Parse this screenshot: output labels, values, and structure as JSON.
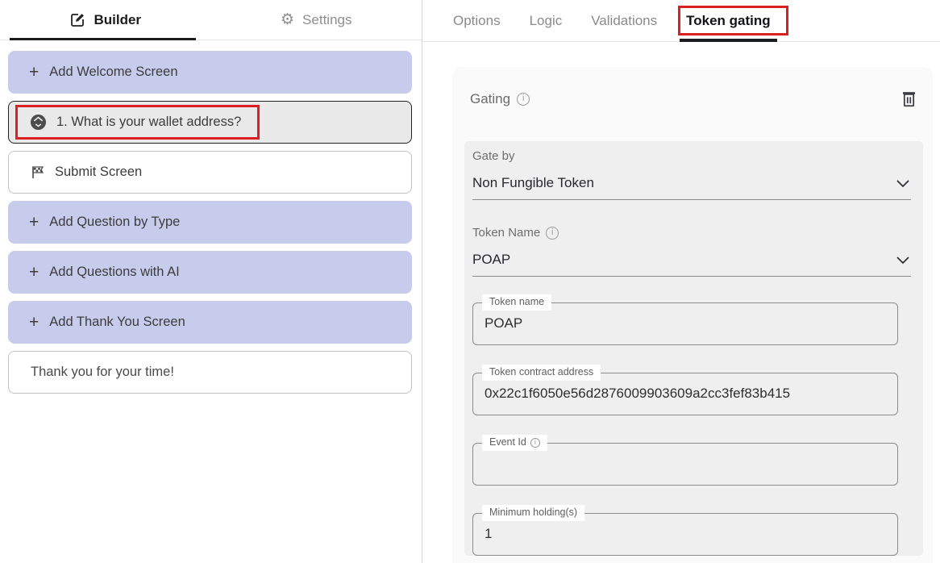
{
  "left_panel": {
    "tabs": [
      {
        "label": "Builder",
        "active": true
      },
      {
        "label": "Settings",
        "active": false
      }
    ],
    "items": [
      {
        "type": "add",
        "label": "Add Welcome Screen"
      },
      {
        "type": "question",
        "label": "1. What is your wallet address?",
        "selected": true,
        "annotated": true
      },
      {
        "type": "submit",
        "label": "Submit Screen"
      },
      {
        "type": "add",
        "label": "Add Question by Type"
      },
      {
        "type": "add",
        "label": "Add Questions with AI"
      },
      {
        "type": "add",
        "label": "Add Thank You Screen"
      },
      {
        "type": "plain",
        "label": "Thank you for your time!"
      }
    ]
  },
  "right_panel": {
    "tabs": [
      {
        "label": "Options",
        "active": false
      },
      {
        "label": "Logic",
        "active": false
      },
      {
        "label": "Validations",
        "active": false
      },
      {
        "label": "Token gating",
        "active": true,
        "annotated": true
      }
    ],
    "section": {
      "title": "Gating",
      "gate_by": {
        "label": "Gate by",
        "value": "Non Fungible Token"
      },
      "token_name": {
        "label": "Token Name",
        "value": "POAP",
        "has_info": true
      },
      "fields": [
        {
          "label": "Token name",
          "value": "POAP",
          "has_info": false
        },
        {
          "label": "Token contract address",
          "value": "0x22c1f6050e56d2876009903609a2cc3fef83b415",
          "has_info": false
        },
        {
          "label": "Event Id",
          "value": "",
          "has_info": true
        },
        {
          "label": "Minimum holding(s)",
          "value": "1",
          "has_info": false
        }
      ]
    }
  },
  "icons": {
    "plus_glyph": "+",
    "gear_glyph": "⚙",
    "info_glyph": "i"
  },
  "colors": {
    "lavender_button": "#c7ccec",
    "selected_item_bg": "#e9e9e9",
    "selected_item_border": "#212121",
    "annotation_red": "#dc2020",
    "active_tab": "#1b1b22",
    "inactive_tab": "#8a8a8a",
    "card_bg": "#fafafa",
    "panel_bg": "#efefef",
    "field_border": "#8c8c8c"
  }
}
